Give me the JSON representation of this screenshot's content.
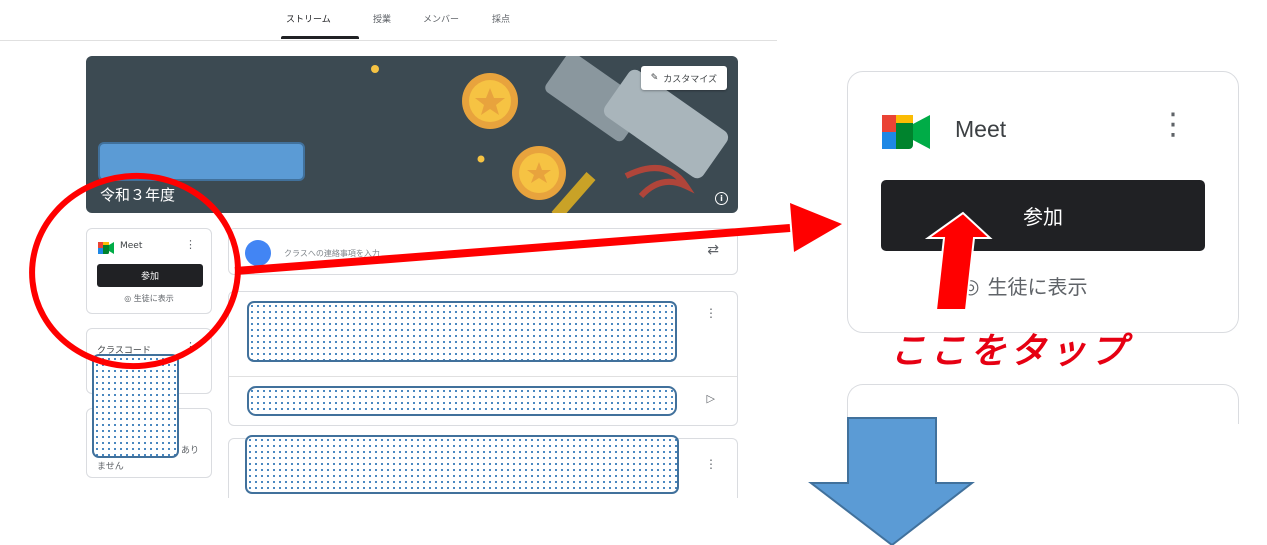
{
  "nav": {
    "tabs": [
      "ストリーム",
      "授業",
      "メンバー",
      "採点"
    ]
  },
  "banner": {
    "customize_label": "カスタマイズ",
    "year_label": "令和３年度"
  },
  "meet_card": {
    "title": "Meet",
    "join_label": "参加",
    "show_label": "生徒に表示"
  },
  "class_code_card": {
    "title": "クラスコード"
  },
  "upcoming_card": {
    "text_1": "あり",
    "text_2": "ません"
  },
  "stream": {
    "announce_placeholder": "クラスへの連絡事項を入力"
  },
  "annotation": {
    "tap_label": "ここをタップ"
  },
  "colors": {
    "annotation_red": "#ff0000",
    "arrow_blue": "#5b9bd5",
    "redact_blue": "#5b9bd5",
    "join_button": "#202124"
  }
}
